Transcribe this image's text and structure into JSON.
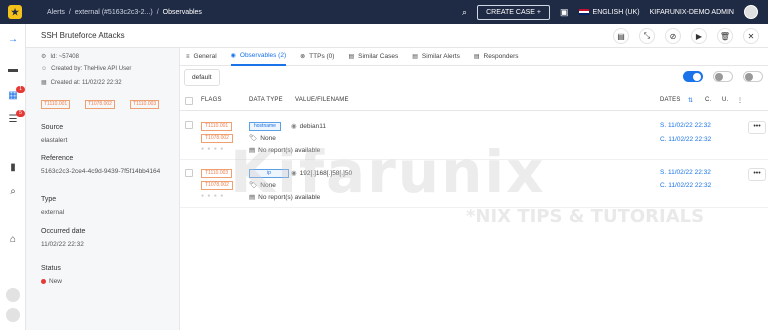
{
  "topbar": {
    "breadcrumb": [
      "Alerts",
      "/",
      "external (#5163c2c3-2...)",
      "/",
      "Observables"
    ],
    "create_case": "CREATE CASE  +",
    "language": "ENGLISH (UK)",
    "user": "KIFARUNIX-DEMO ADMIN"
  },
  "nav": {
    "badges": [
      "1",
      "5"
    ]
  },
  "case": {
    "title": "SSH Bruteforce Attacks",
    "id": "Id: ~57408",
    "created_by": "Created by: TheHive API User",
    "created_at": "Created at: 11/02/22 22:32",
    "tags": [
      "T1110.001",
      "T1078.002",
      "T1110.003"
    ],
    "source_label": "Source",
    "source": "elastalert",
    "reference_label": "Reference",
    "reference": "5163c2c3-2ce4-4c9d-9439-7f5f14bb4164",
    "type_label": "Type",
    "type": "external",
    "occurred_label": "Occurred date",
    "occurred": "11/02/22 22:32",
    "status_label": "Status",
    "status": "New"
  },
  "tabs": [
    {
      "label": "General",
      "icon": "≡"
    },
    {
      "label": "Observables (2)",
      "icon": "◉"
    },
    {
      "label": "TTPs (0)",
      "icon": "⊗"
    },
    {
      "label": "Similar Cases",
      "icon": "▤"
    },
    {
      "label": "Similar Alerts",
      "icon": "▤"
    },
    {
      "label": "Responders",
      "icon": "▤"
    }
  ],
  "filter": {
    "default_label": "default"
  },
  "table": {
    "headers": {
      "flags": "FLAGS",
      "datatype": "DATA TYPE",
      "value": "VALUE/FILENAME",
      "dates": "DATES",
      "c": "C.",
      "u": "U."
    },
    "sort_icon": "⇅",
    "rows": [
      {
        "flags": [
          "T1110.001",
          "T1078.002"
        ],
        "datatype": "hostname",
        "value": "debian11",
        "none_label": "None",
        "report": "No report(s) available",
        "date_s": "S. 11/02/22 22:32",
        "date_c": "C. 11/02/22 22:32"
      },
      {
        "flags": [
          "T1110.003",
          "T1078.002"
        ],
        "datatype": "ip",
        "value": "192[.]168[.]58[.]50",
        "none_label": "None",
        "report": "No report(s) available",
        "date_s": "S. 11/02/22 22:32",
        "date_c": "C. 11/02/22 22:32"
      }
    ]
  },
  "watermark": {
    "main": "Kifarunix",
    "sub": "*NIX TIPS & TUTORIALS"
  },
  "colors": {
    "topbar": "#1f2a44",
    "accent": "#1a73e8",
    "tag": "#f08050",
    "status_new": "#e53935"
  }
}
